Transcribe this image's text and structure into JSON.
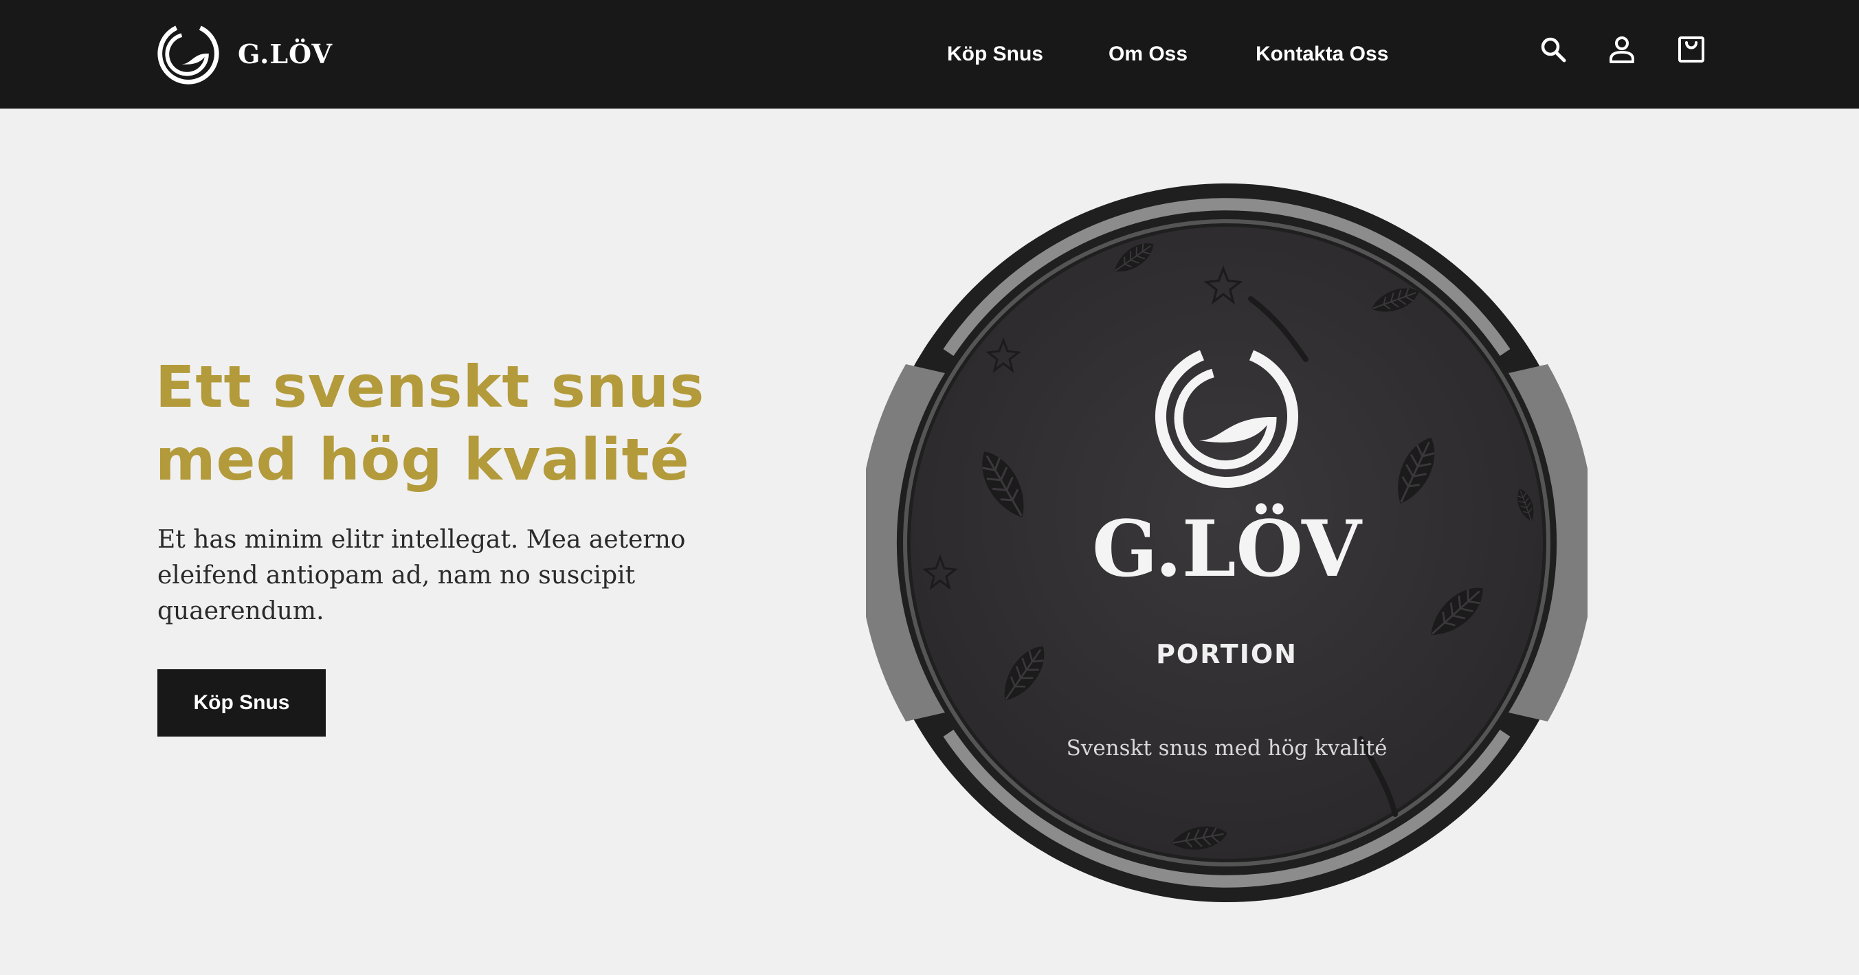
{
  "header": {
    "brand": "G.LÖV",
    "nav": [
      {
        "label": "Köp Snus"
      },
      {
        "label": "Om Oss"
      },
      {
        "label": "Kontakta Oss"
      }
    ],
    "icons": [
      "search-icon",
      "user-icon",
      "shopping-bag-icon"
    ]
  },
  "hero": {
    "title": "Ett svenskt snus med hög kvalité",
    "text": "Et has minim elitr intellegat. Mea aeterno eleifend antiopam ad, nam no suscipit quaerendum.",
    "cta_label": "Köp Snus"
  },
  "product": {
    "brand": "G.LÖV",
    "type": "PORTION",
    "tagline": "Svenskt snus med hög kvalité"
  },
  "colors": {
    "header_bg": "#181818",
    "page_bg": "#f0f0f0",
    "accent_gold": "#b39a3b",
    "tin_dark": "#333133",
    "text_dark": "#2a2a2a"
  }
}
